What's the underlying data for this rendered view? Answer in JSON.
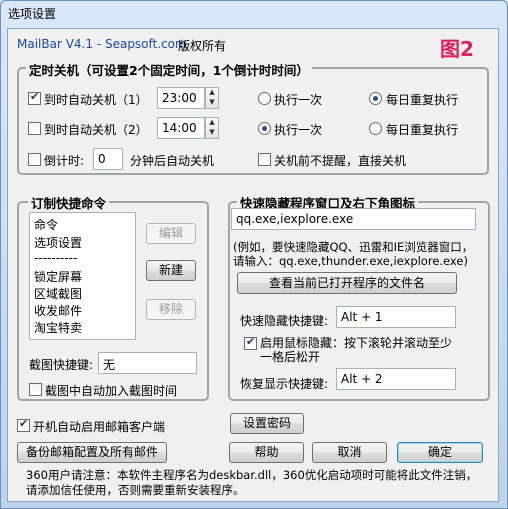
{
  "window": {
    "title": "选项设置"
  },
  "header": {
    "app_name": "MailBar V4.1 - Seapsoft.com",
    "copyright": "版权所有",
    "figure_label": "图2"
  },
  "shutdown_group": {
    "title": "定时关机（可设置2个固定时间，1个倒计时时间）",
    "row1": {
      "checked": true,
      "label": "到时自动关机（1）",
      "time": "23:00",
      "radio_once": "执行一次",
      "radio_daily": "每日重复执行",
      "selected": "daily"
    },
    "row2": {
      "checked": false,
      "label": "到时自动关机（2）",
      "time": "14:00",
      "radio_once": "执行一次",
      "radio_daily": "每日重复执行",
      "selected": "once"
    },
    "countdown": {
      "checked": false,
      "label": "倒计时:",
      "value": "0",
      "suffix": "分钟后自动关机"
    },
    "no_prompt": {
      "checked": false,
      "label": "关机前不提醒，直接关机"
    }
  },
  "commands_group": {
    "title": "订制快捷命令",
    "list_items": [
      "命令",
      "选项设置",
      "----------",
      "锁定屏幕",
      "区域截图",
      "收发邮件",
      "淘宝特卖"
    ],
    "edit_button": "编辑",
    "new_button": "新建",
    "remove_button": "移除",
    "screenshot_hotkey_label": "截图快捷键:",
    "screenshot_hotkey_value": "无",
    "auto_add_time": {
      "checked": false,
      "label": "截图中自动加入截图时间"
    }
  },
  "hide_group": {
    "title": "快速隐藏程序窗口及右下角图标",
    "programs_value": "qq.exe,iexplore.exe",
    "hint_line1": "(例如，要快速隐藏QQ、迅雷和IE浏览器窗口，",
    "hint_line2": "请输入：qq.exe,thunder.exe,iexplore.exe)",
    "view_button": "查看当前已打开程序的文件名",
    "hide_hotkey_label": "快速隐藏快捷键:",
    "hide_hotkey_value": "Alt + 1",
    "mouse_hide": {
      "checked": true,
      "label1": "启用鼠标隐藏：按下滚轮并滚动至少",
      "label2": "一格后松开"
    },
    "restore_hotkey_label": "恢复显示快捷键:",
    "restore_hotkey_value": "Alt + 2"
  },
  "footer": {
    "autostart": {
      "checked": true,
      "label": "开机自动启用邮箱客户端"
    },
    "set_password_button": "设置密码",
    "backup_button": "备份邮箱配置及所有邮件",
    "help_button": "帮助",
    "cancel_button": "取消",
    "ok_button": "确定",
    "note_line1": "360用户请注意：本软件主程序名为deskbar.dll，360优化启动项时可能将此文件注销，",
    "note_line2": "请添加信任使用，否则需要重新安装程序。"
  }
}
